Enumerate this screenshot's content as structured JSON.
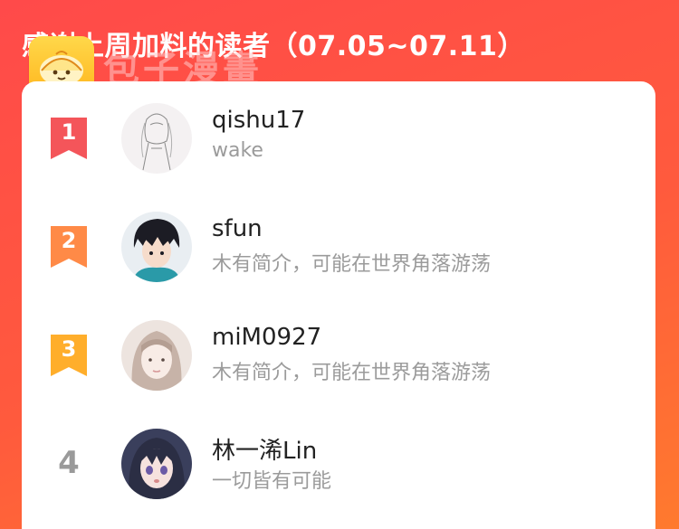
{
  "header": {
    "title": "感谢上周加料的读者（07.05~07.11）"
  },
  "watermark": {
    "text": "包子漫畫"
  },
  "colors": {
    "background_start": "#ff4a4a",
    "background_end": "#ff7a2e",
    "rank1": "#f4555a",
    "rank2": "#ff8a47",
    "rank3": "#ffae2b",
    "rank_plain": "#9a9a9a"
  },
  "readers": [
    {
      "rank": "1",
      "name": "qishu17",
      "bio": "wake",
      "avatar": "sketch-girl-avatar"
    },
    {
      "rank": "2",
      "name": "sfun",
      "bio": "木有简介，可能在世界角落游荡",
      "avatar": "anime-boy-avatar"
    },
    {
      "rank": "3",
      "name": "miM0927",
      "bio": "木有简介，可能在世界角落游荡",
      "avatar": "girl-photo-avatar"
    },
    {
      "rank": "4",
      "name": "林一浠Lin",
      "bio": "一切皆有可能",
      "avatar": "anime-girl-avatar"
    }
  ]
}
